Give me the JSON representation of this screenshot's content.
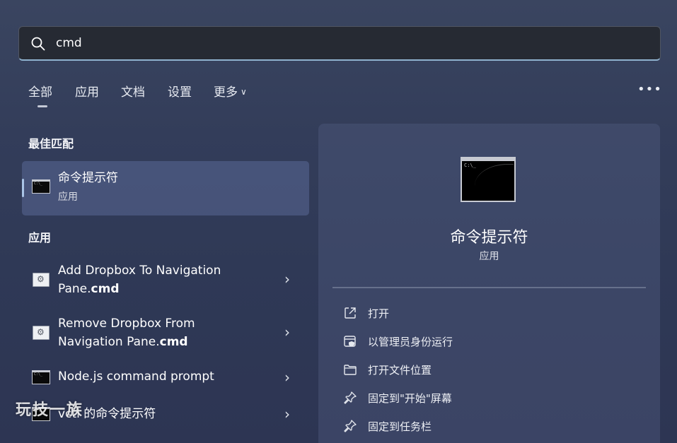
{
  "search": {
    "value": "cmd"
  },
  "tabs": [
    {
      "label": "全部"
    },
    {
      "label": "应用"
    },
    {
      "label": "文档"
    },
    {
      "label": "设置"
    },
    {
      "label": "更多"
    }
  ],
  "more_options_label": "•••",
  "best_match": {
    "section_title": "最佳匹配",
    "title": "命令提示符",
    "subtitle": "应用"
  },
  "apps": {
    "section_title": "应用",
    "items": [
      {
        "line1": "Add Dropbox To Navigation",
        "line2_prefix": "Pane.",
        "line2_bold": "cmd",
        "icon": "gear-file-icon"
      },
      {
        "line1": "Remove Dropbox From",
        "line2_prefix": "Navigation Pane.",
        "line2_bold": "cmd",
        "icon": "gear-file-icon"
      },
      {
        "line1": "Node.js command prompt",
        "icon": "cmd-icon"
      },
      {
        "line1": "vctl 的命令提示符",
        "icon": "cmd-icon"
      }
    ]
  },
  "details": {
    "title": "命令提示符",
    "subtitle": "应用",
    "actions": [
      {
        "label": "打开",
        "icon": "open-external-icon"
      },
      {
        "label": "以管理员身份运行",
        "icon": "admin-shield-icon"
      },
      {
        "label": "打开文件位置",
        "icon": "folder-icon"
      },
      {
        "label": "固定到\"开始\"屏幕",
        "icon": "pin-icon"
      },
      {
        "label": "固定到任务栏",
        "icon": "pin-icon"
      }
    ]
  },
  "watermark": "玩技一族"
}
